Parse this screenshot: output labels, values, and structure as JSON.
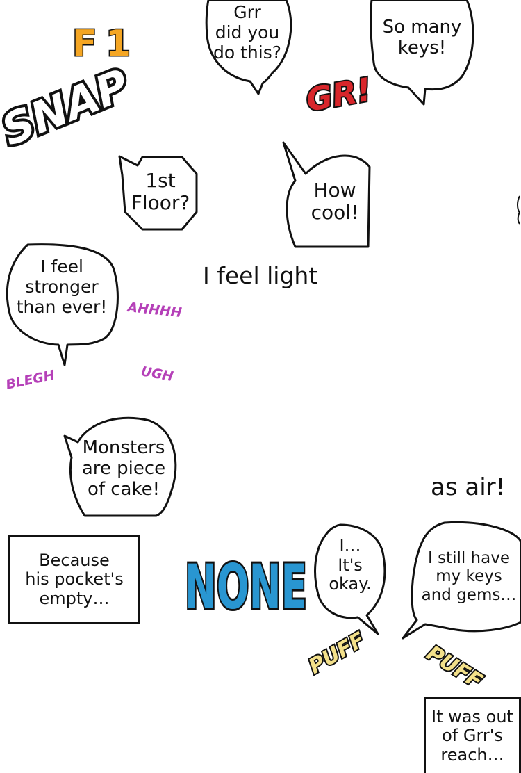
{
  "panel_marker": {
    "letter": "F",
    "number": "1",
    "color": "#f5a623"
  },
  "bubbles": {
    "grr_question": [
      "Grr",
      "did you",
      "do this?"
    ],
    "so_many_keys": [
      "So many",
      "keys!"
    ],
    "first_floor": [
      "1st",
      "Floor?"
    ],
    "how_cool": [
      "How",
      "cool!"
    ],
    "feel_stronger": [
      "I feel",
      "stronger",
      "than ever!"
    ],
    "monsters": [
      "Monsters",
      "are piece",
      "of cake!"
    ],
    "its_okay": [
      "I…",
      "It's",
      "okay."
    ],
    "keys_gems": [
      "I still have",
      "my keys",
      "and gems…"
    ]
  },
  "narration": {
    "feel_light": "I feel light",
    "as_air": "as air!"
  },
  "caption_boxes": {
    "pocket_empty": [
      "Because",
      "his pocket's",
      "empty…"
    ],
    "out_of_reach": [
      "It was out",
      "of Grr's",
      "reach…"
    ]
  },
  "sound_effects": {
    "snap": "SNAP",
    "gr": "GR!",
    "ahhhh": "AHHHH",
    "blegh": "BLEGH",
    "ugh": "UGH",
    "none": "NONE",
    "puff_1": "PUFF",
    "puff_2": "PUFF"
  },
  "colors": {
    "gr_red": "#d8262b",
    "shout_purple": "#b540b8",
    "none_blue": "#2996d1",
    "puff_yellow": "#f3e08a",
    "ink": "#111111"
  }
}
